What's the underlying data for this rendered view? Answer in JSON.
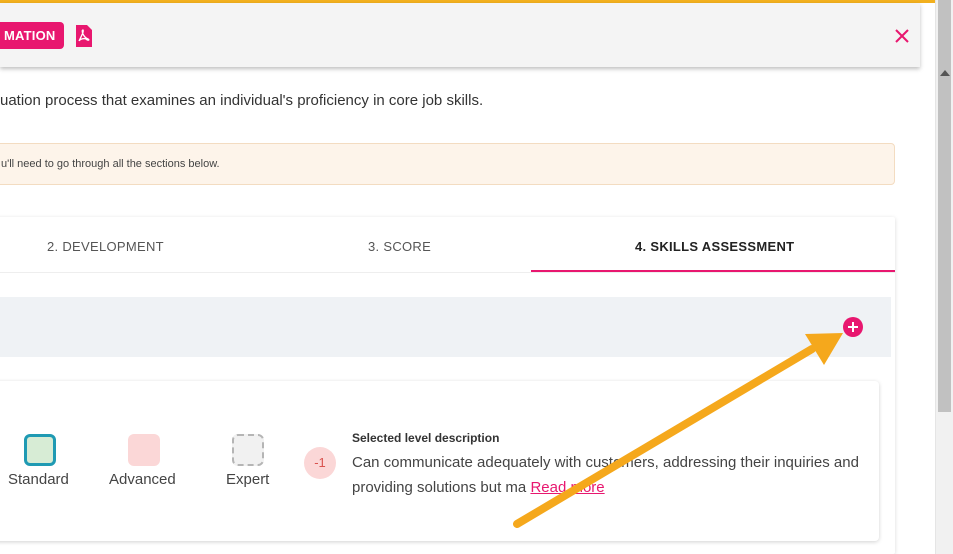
{
  "header": {
    "info_button_label": "MATION",
    "pdf_icon": "pdf-icon",
    "close_icon": "close-icon"
  },
  "intro_text": "uation process that examines an individual's proficiency in core job skills.",
  "notice_text": "u'll need to go through all the sections below.",
  "tabs": [
    {
      "label": "2. DEVELOPMENT"
    },
    {
      "label": "3. SCORE"
    },
    {
      "label": "4. SKILLS ASSESSMENT",
      "active": true
    }
  ],
  "add_icon": "plus-circle-icon",
  "skill": {
    "levels": [
      {
        "label": "Standard",
        "state": "selected"
      },
      {
        "label": "Advanced",
        "state": "required"
      },
      {
        "label": "Expert",
        "state": "empty"
      }
    ],
    "gap": "-1",
    "description_title": "Selected level description",
    "description_text": "Can communicate adequately with customers, addressing their inquiries and providing solutions but ma",
    "read_more": "Read more"
  },
  "colors": {
    "accent": "#e8176f",
    "top_bar": "#f2b01e",
    "arrow": "#f5a81c",
    "standard_border": "#1f9ab3"
  }
}
